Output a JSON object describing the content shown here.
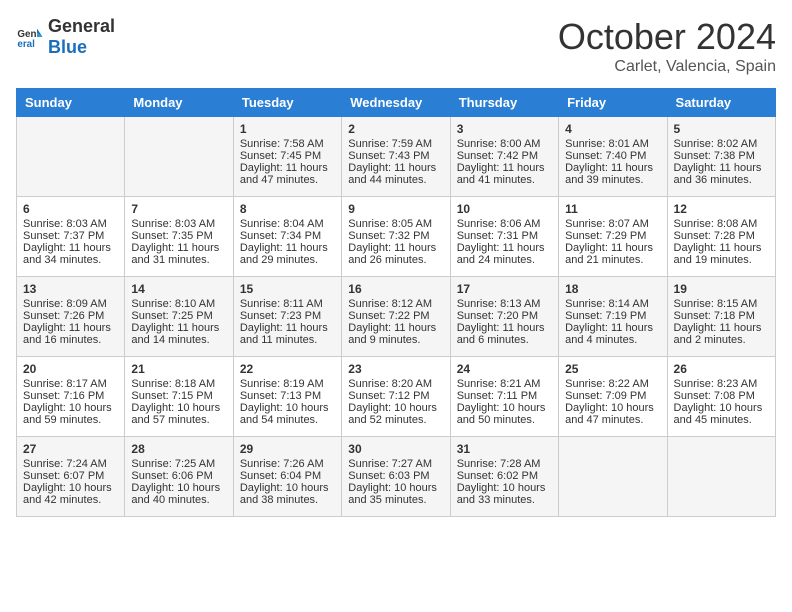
{
  "logo": {
    "general": "General",
    "blue": "Blue"
  },
  "header": {
    "month": "October 2024",
    "location": "Carlet, Valencia, Spain"
  },
  "days_of_week": [
    "Sunday",
    "Monday",
    "Tuesday",
    "Wednesday",
    "Thursday",
    "Friday",
    "Saturday"
  ],
  "weeks": [
    [
      {
        "day": "",
        "sunrise": "",
        "sunset": "",
        "daylight": ""
      },
      {
        "day": "",
        "sunrise": "",
        "sunset": "",
        "daylight": ""
      },
      {
        "day": "1",
        "sunrise": "Sunrise: 7:58 AM",
        "sunset": "Sunset: 7:45 PM",
        "daylight": "Daylight: 11 hours and 47 minutes."
      },
      {
        "day": "2",
        "sunrise": "Sunrise: 7:59 AM",
        "sunset": "Sunset: 7:43 PM",
        "daylight": "Daylight: 11 hours and 44 minutes."
      },
      {
        "day": "3",
        "sunrise": "Sunrise: 8:00 AM",
        "sunset": "Sunset: 7:42 PM",
        "daylight": "Daylight: 11 hours and 41 minutes."
      },
      {
        "day": "4",
        "sunrise": "Sunrise: 8:01 AM",
        "sunset": "Sunset: 7:40 PM",
        "daylight": "Daylight: 11 hours and 39 minutes."
      },
      {
        "day": "5",
        "sunrise": "Sunrise: 8:02 AM",
        "sunset": "Sunset: 7:38 PM",
        "daylight": "Daylight: 11 hours and 36 minutes."
      }
    ],
    [
      {
        "day": "6",
        "sunrise": "Sunrise: 8:03 AM",
        "sunset": "Sunset: 7:37 PM",
        "daylight": "Daylight: 11 hours and 34 minutes."
      },
      {
        "day": "7",
        "sunrise": "Sunrise: 8:03 AM",
        "sunset": "Sunset: 7:35 PM",
        "daylight": "Daylight: 11 hours and 31 minutes."
      },
      {
        "day": "8",
        "sunrise": "Sunrise: 8:04 AM",
        "sunset": "Sunset: 7:34 PM",
        "daylight": "Daylight: 11 hours and 29 minutes."
      },
      {
        "day": "9",
        "sunrise": "Sunrise: 8:05 AM",
        "sunset": "Sunset: 7:32 PM",
        "daylight": "Daylight: 11 hours and 26 minutes."
      },
      {
        "day": "10",
        "sunrise": "Sunrise: 8:06 AM",
        "sunset": "Sunset: 7:31 PM",
        "daylight": "Daylight: 11 hours and 24 minutes."
      },
      {
        "day": "11",
        "sunrise": "Sunrise: 8:07 AM",
        "sunset": "Sunset: 7:29 PM",
        "daylight": "Daylight: 11 hours and 21 minutes."
      },
      {
        "day": "12",
        "sunrise": "Sunrise: 8:08 AM",
        "sunset": "Sunset: 7:28 PM",
        "daylight": "Daylight: 11 hours and 19 minutes."
      }
    ],
    [
      {
        "day": "13",
        "sunrise": "Sunrise: 8:09 AM",
        "sunset": "Sunset: 7:26 PM",
        "daylight": "Daylight: 11 hours and 16 minutes."
      },
      {
        "day": "14",
        "sunrise": "Sunrise: 8:10 AM",
        "sunset": "Sunset: 7:25 PM",
        "daylight": "Daylight: 11 hours and 14 minutes."
      },
      {
        "day": "15",
        "sunrise": "Sunrise: 8:11 AM",
        "sunset": "Sunset: 7:23 PM",
        "daylight": "Daylight: 11 hours and 11 minutes."
      },
      {
        "day": "16",
        "sunrise": "Sunrise: 8:12 AM",
        "sunset": "Sunset: 7:22 PM",
        "daylight": "Daylight: 11 hours and 9 minutes."
      },
      {
        "day": "17",
        "sunrise": "Sunrise: 8:13 AM",
        "sunset": "Sunset: 7:20 PM",
        "daylight": "Daylight: 11 hours and 6 minutes."
      },
      {
        "day": "18",
        "sunrise": "Sunrise: 8:14 AM",
        "sunset": "Sunset: 7:19 PM",
        "daylight": "Daylight: 11 hours and 4 minutes."
      },
      {
        "day": "19",
        "sunrise": "Sunrise: 8:15 AM",
        "sunset": "Sunset: 7:18 PM",
        "daylight": "Daylight: 11 hours and 2 minutes."
      }
    ],
    [
      {
        "day": "20",
        "sunrise": "Sunrise: 8:17 AM",
        "sunset": "Sunset: 7:16 PM",
        "daylight": "Daylight: 10 hours and 59 minutes."
      },
      {
        "day": "21",
        "sunrise": "Sunrise: 8:18 AM",
        "sunset": "Sunset: 7:15 PM",
        "daylight": "Daylight: 10 hours and 57 minutes."
      },
      {
        "day": "22",
        "sunrise": "Sunrise: 8:19 AM",
        "sunset": "Sunset: 7:13 PM",
        "daylight": "Daylight: 10 hours and 54 minutes."
      },
      {
        "day": "23",
        "sunrise": "Sunrise: 8:20 AM",
        "sunset": "Sunset: 7:12 PM",
        "daylight": "Daylight: 10 hours and 52 minutes."
      },
      {
        "day": "24",
        "sunrise": "Sunrise: 8:21 AM",
        "sunset": "Sunset: 7:11 PM",
        "daylight": "Daylight: 10 hours and 50 minutes."
      },
      {
        "day": "25",
        "sunrise": "Sunrise: 8:22 AM",
        "sunset": "Sunset: 7:09 PM",
        "daylight": "Daylight: 10 hours and 47 minutes."
      },
      {
        "day": "26",
        "sunrise": "Sunrise: 8:23 AM",
        "sunset": "Sunset: 7:08 PM",
        "daylight": "Daylight: 10 hours and 45 minutes."
      }
    ],
    [
      {
        "day": "27",
        "sunrise": "Sunrise: 7:24 AM",
        "sunset": "Sunset: 6:07 PM",
        "daylight": "Daylight: 10 hours and 42 minutes."
      },
      {
        "day": "28",
        "sunrise": "Sunrise: 7:25 AM",
        "sunset": "Sunset: 6:06 PM",
        "daylight": "Daylight: 10 hours and 40 minutes."
      },
      {
        "day": "29",
        "sunrise": "Sunrise: 7:26 AM",
        "sunset": "Sunset: 6:04 PM",
        "daylight": "Daylight: 10 hours and 38 minutes."
      },
      {
        "day": "30",
        "sunrise": "Sunrise: 7:27 AM",
        "sunset": "Sunset: 6:03 PM",
        "daylight": "Daylight: 10 hours and 35 minutes."
      },
      {
        "day": "31",
        "sunrise": "Sunrise: 7:28 AM",
        "sunset": "Sunset: 6:02 PM",
        "daylight": "Daylight: 10 hours and 33 minutes."
      },
      {
        "day": "",
        "sunrise": "",
        "sunset": "",
        "daylight": ""
      },
      {
        "day": "",
        "sunrise": "",
        "sunset": "",
        "daylight": ""
      }
    ]
  ]
}
